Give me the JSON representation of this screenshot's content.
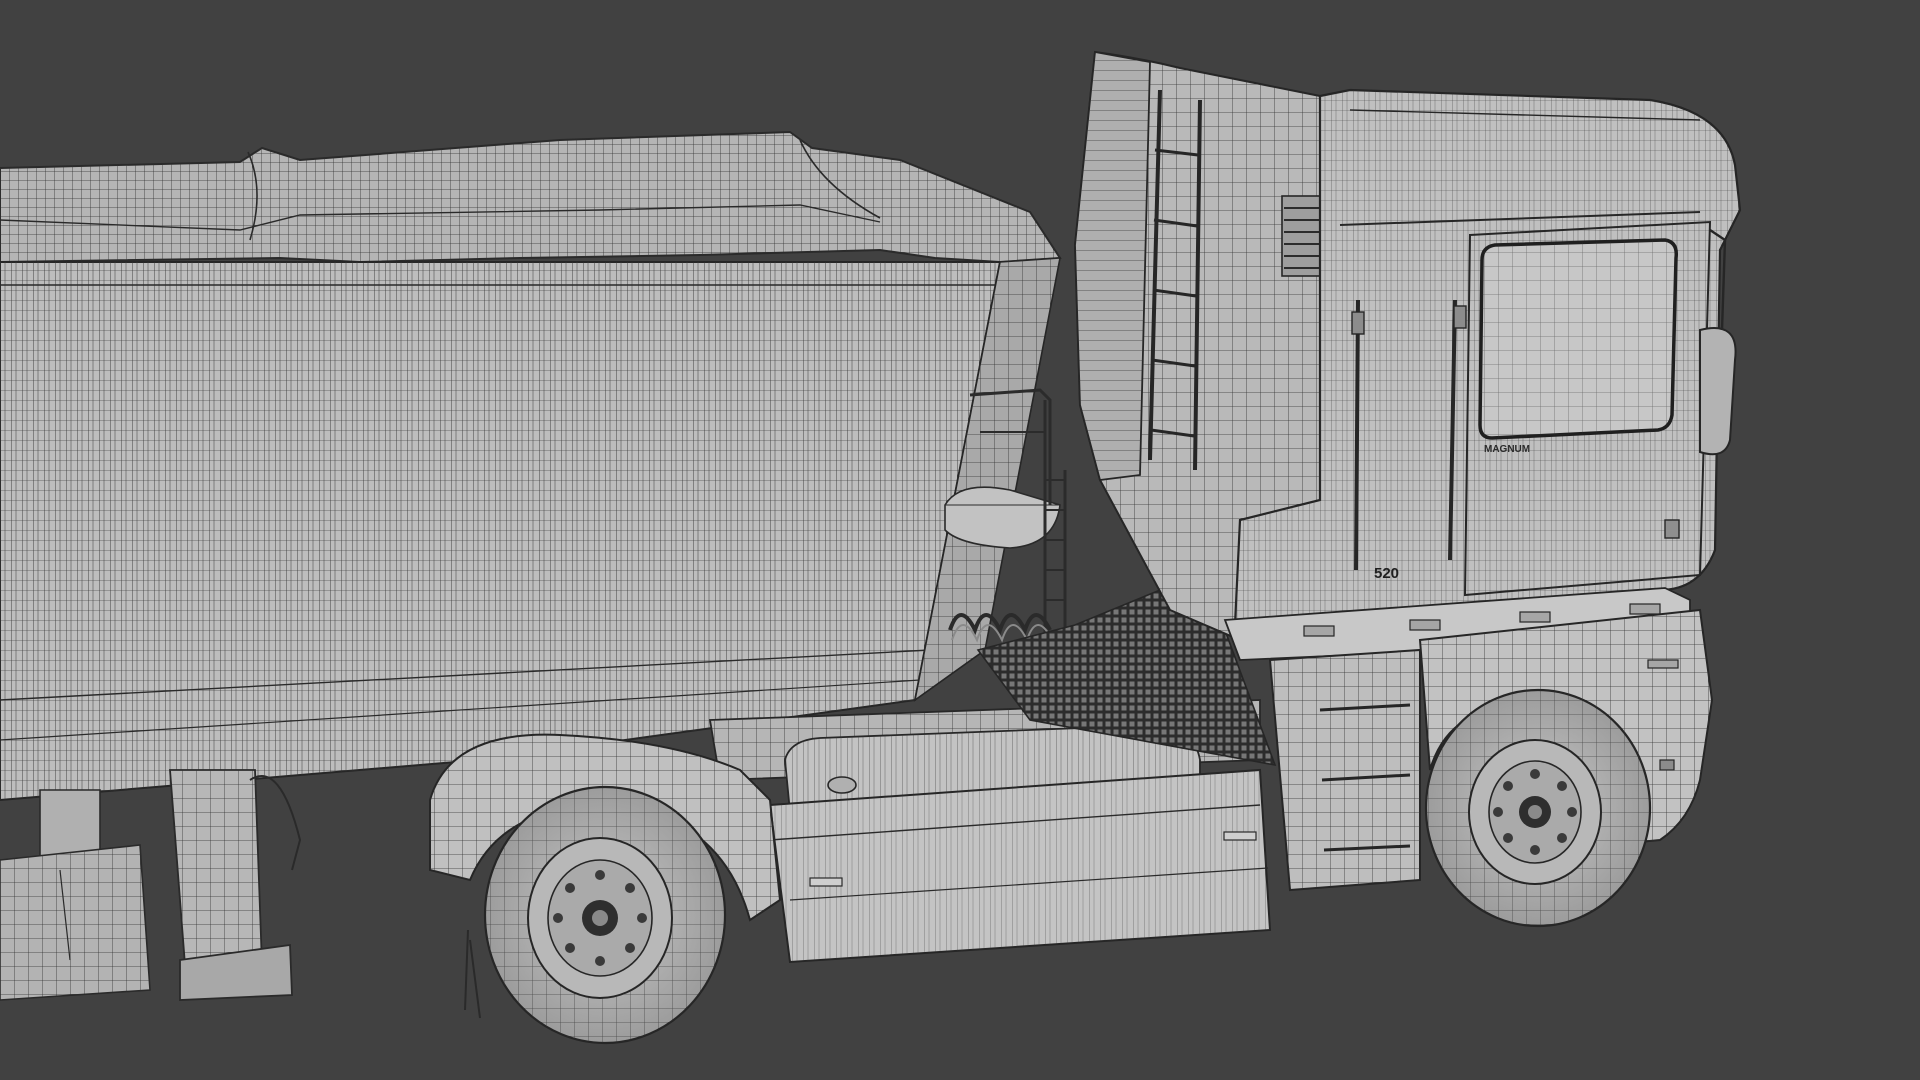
{
  "scene": {
    "subject": "wireframe-truck-with-tipper-trailer",
    "colors": {
      "background": "#414141",
      "surface": "#b9b9b9",
      "surface_dark": "#8f8f8f",
      "wire": "#2a2a2a",
      "wire_light": "#555555"
    }
  },
  "labels": {
    "cab_model_number": "520",
    "cab_badge": "MAGNUM"
  }
}
